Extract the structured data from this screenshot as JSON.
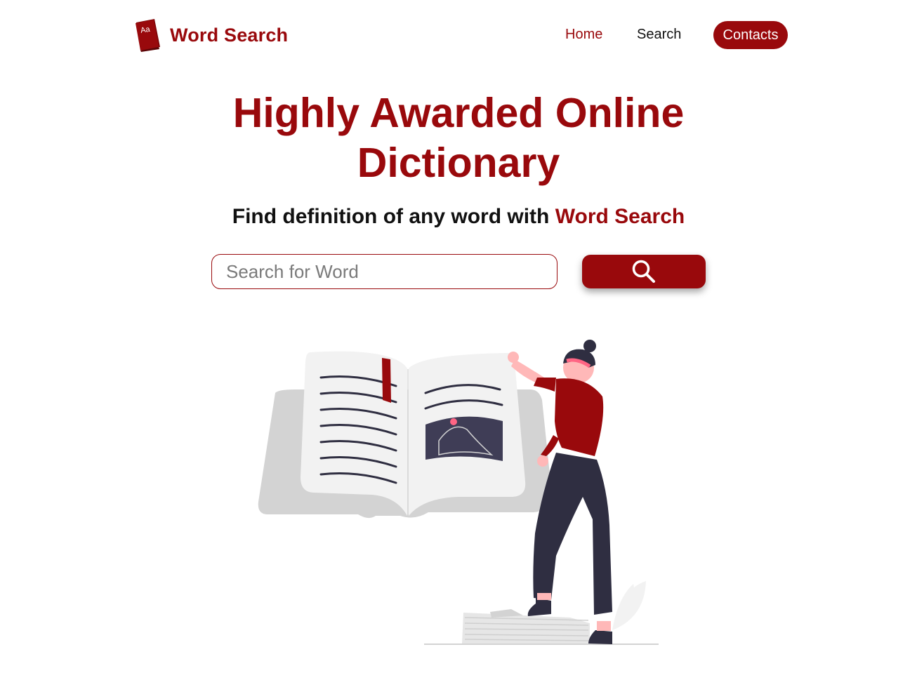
{
  "header": {
    "brand": {
      "logo_icon": "dictionary-book-icon",
      "logo_text": "Aa",
      "name": "Word Search"
    },
    "nav": {
      "home": "Home",
      "search": "Search",
      "contacts": "Contacts",
      "active": "home"
    }
  },
  "hero": {
    "title_line1": "Highly Awarded Online",
    "title_line2": "Dictionary",
    "subtitle_prefix": "Find definition of any word with",
    "subtitle_accent": "Word Search"
  },
  "search": {
    "placeholder": "Search for Word",
    "value": "",
    "button_icon": "search-icon"
  },
  "illustration": {
    "icon": "woman-reading-open-book-illustration"
  },
  "colors": {
    "brand": "#99090c",
    "text": "#111111",
    "muted": "#7a7a7a",
    "ink": "#2f2e41",
    "paper": "#f2f2f2",
    "shadow": "#d3d3d3",
    "skin": "#ffb8b8",
    "accent_pink": "#ff6584"
  }
}
